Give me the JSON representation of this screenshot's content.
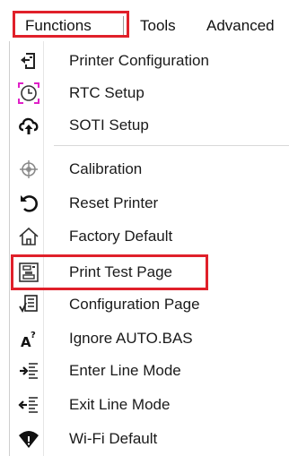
{
  "menubar": {
    "items": [
      {
        "label": "Functions",
        "selected": true
      },
      {
        "label": "Tools"
      },
      {
        "label": "Advanced"
      }
    ]
  },
  "menu": {
    "items": [
      {
        "label": "Printer Configuration",
        "icon": "printer-config-icon"
      },
      {
        "label": "RTC Setup",
        "icon": "clock-icon"
      },
      {
        "label": "SOTI Setup",
        "icon": "cloud-upload-icon"
      },
      {
        "label": "Calibration",
        "icon": "calibration-icon"
      },
      {
        "label": "Reset Printer",
        "icon": "reset-icon"
      },
      {
        "label": "Factory Default",
        "icon": "home-icon"
      },
      {
        "label": "Print Test Page",
        "icon": "print-test-page-icon",
        "highlighted": true
      },
      {
        "label": "Configuration Page",
        "icon": "configuration-page-icon"
      },
      {
        "label": "Ignore AUTO.BAS",
        "icon": "ignore-auto-bas-icon"
      },
      {
        "label": "Enter Line Mode",
        "icon": "enter-line-mode-icon"
      },
      {
        "label": "Exit Line Mode",
        "icon": "exit-line-mode-icon"
      },
      {
        "label": "Wi-Fi Default",
        "icon": "wifi-default-icon"
      }
    ]
  },
  "colors": {
    "highlight_border": "#e0202a",
    "text": "#1a1a1a",
    "icon": "#222222",
    "clock_corner": "#e020c8"
  }
}
